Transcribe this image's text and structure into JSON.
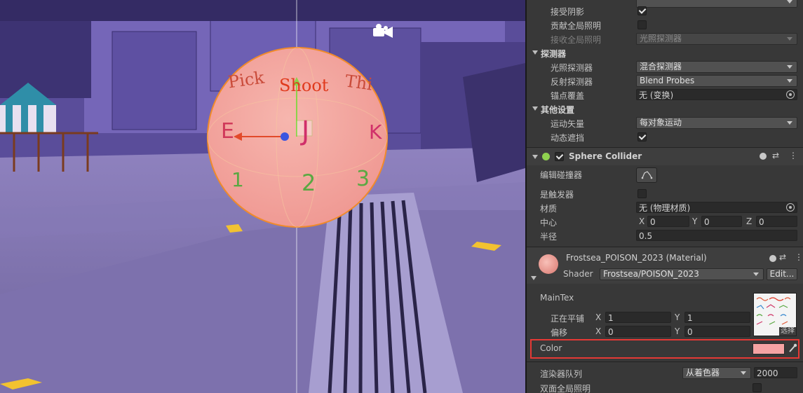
{
  "scene": {
    "sphere_letters": [
      "Pick",
      "Shoot",
      "Thi",
      "E",
      "J",
      "K",
      "1",
      "2",
      "3"
    ]
  },
  "inspector": {
    "mesh_renderer": {
      "receive_shadows_label": "接受阴影",
      "receive_shadows_checked": true,
      "contribute_gi_label": "贡献全局照明",
      "contribute_gi_checked": false,
      "receive_gi_label": "接收全局照明",
      "receive_gi_value": "光照探测器",
      "probes_header": "探测器",
      "light_probes_label": "光照探测器",
      "light_probes_value": "混合探测器",
      "reflection_probes_label": "反射探测器",
      "reflection_probes_value": "Blend Probes",
      "anchor_override_label": "锚点覆盖",
      "anchor_override_value": "无 (变换)",
      "other_header": "其他设置",
      "motion_vectors_label": "运动矢量",
      "motion_vectors_value": "每对象运动",
      "dynamic_occlusion_label": "动态遮挡",
      "dynamic_occlusion_checked": true
    },
    "sphere_collider": {
      "title": "Sphere Collider",
      "enabled": true,
      "edit_collider_label": "编辑碰撞器",
      "is_trigger_label": "是触发器",
      "is_trigger_checked": false,
      "material_label": "材质",
      "material_value": "无 (物理材质)",
      "center_label": "中心",
      "center": {
        "x_label": "X",
        "x": "0",
        "y_label": "Y",
        "y": "0",
        "z_label": "Z",
        "z": "0"
      },
      "radius_label": "半径",
      "radius_value": "0.5"
    },
    "material": {
      "title": "Frostsea_POISON_2023 (Material)",
      "shader_label": "Shader",
      "shader_value": "Frostsea/POISON_2023",
      "edit_button": "Edit...",
      "main_tex_label": "MainTex",
      "tiling_label": "正在平铺",
      "tiling": {
        "x_label": "X",
        "x": "1",
        "y_label": "Y",
        "y": "1"
      },
      "offset_label": "偏移",
      "offset": {
        "x_label": "X",
        "x": "0",
        "y_label": "Y",
        "y": "0"
      },
      "select_label": "选择",
      "color_label": "Color",
      "color_value": "#f5a3a3",
      "render_queue_label": "渲染器队列",
      "render_queue_mode": "从着色器",
      "render_queue_value": "2000",
      "double_sided_gi_label": "双面全局照明",
      "double_sided_gi_checked": false
    }
  },
  "colors": {
    "highlight_border": "#e53935",
    "component_enabled": "#8fd14f",
    "sphere_tint": "#f5a3a3"
  }
}
